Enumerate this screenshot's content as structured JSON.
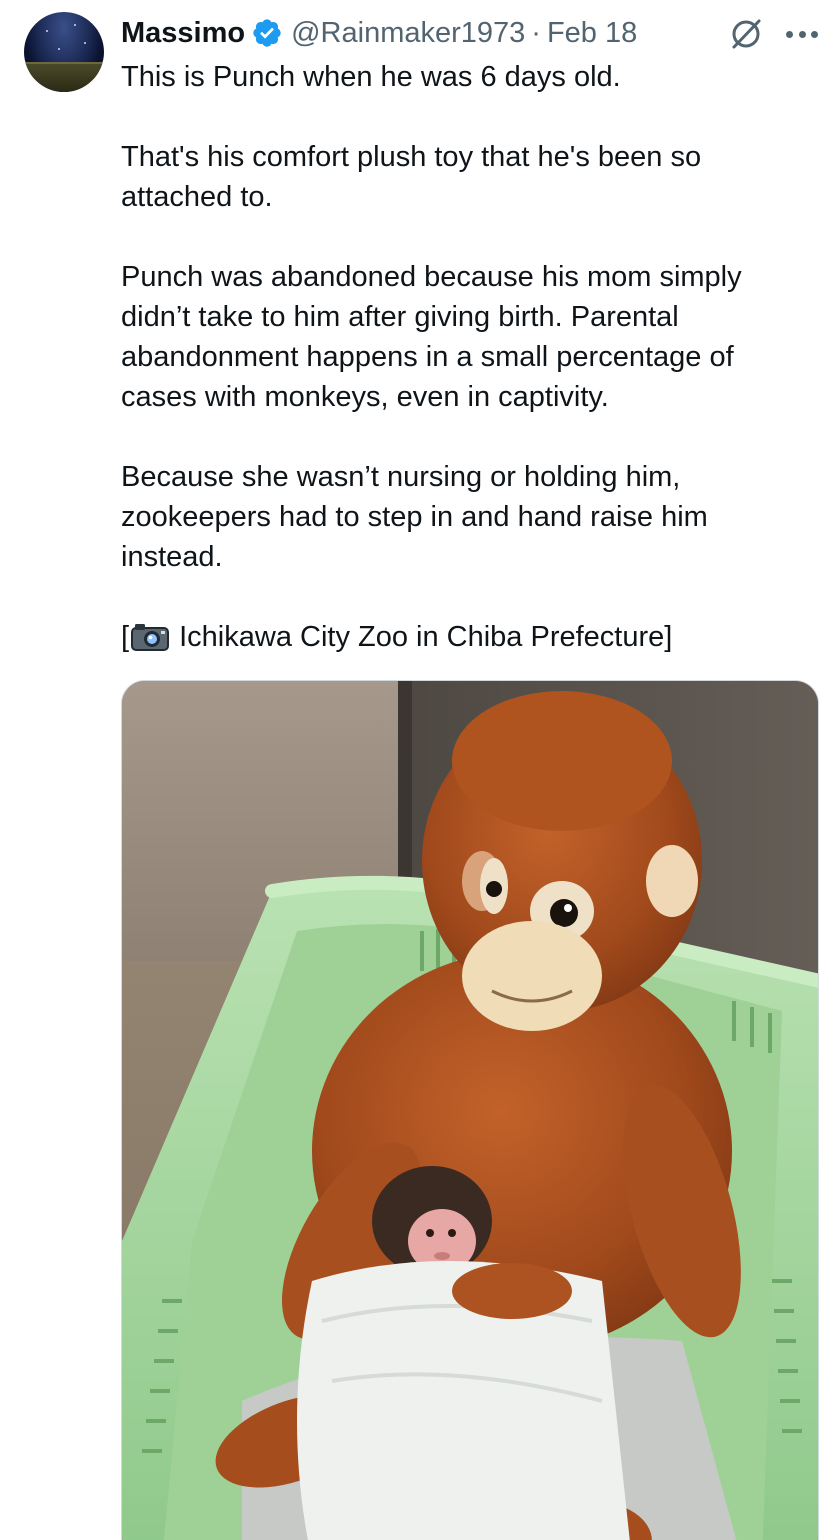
{
  "author": {
    "name": "Massimo",
    "handle": "@Rainmaker1973",
    "separator": "·",
    "date": "Feb 18"
  },
  "tweet": {
    "line1": "This is Punch when he was 6 days old.",
    "line2": "That's his comfort plush toy that he's been so",
    "line3": "attached to.",
    "line4": "Punch was abandoned because his mom simply",
    "line5": "didn’t take to him after giving birth.  Parental",
    "line6": "abandonment happens in a small percentage of",
    "line7": "cases with monkeys, even in captivity.",
    "line8": "Because she wasn’t nursing or holding him,",
    "line9": "zookeepers had to step in and hand raise him",
    "line10": "instead.",
    "credit_open": "[",
    "credit_text": " Ichikawa City Zoo in Chiba Prefecture]"
  },
  "icons": {
    "verified": "verified-badge-icon",
    "grok": "grok-icon",
    "more": "more-icon",
    "camera": "camera-emoji-icon"
  },
  "colors": {
    "text": "#0f1419",
    "secondary": "#536471",
    "verified": "#1d9bf0",
    "border": "#cfd9de"
  }
}
